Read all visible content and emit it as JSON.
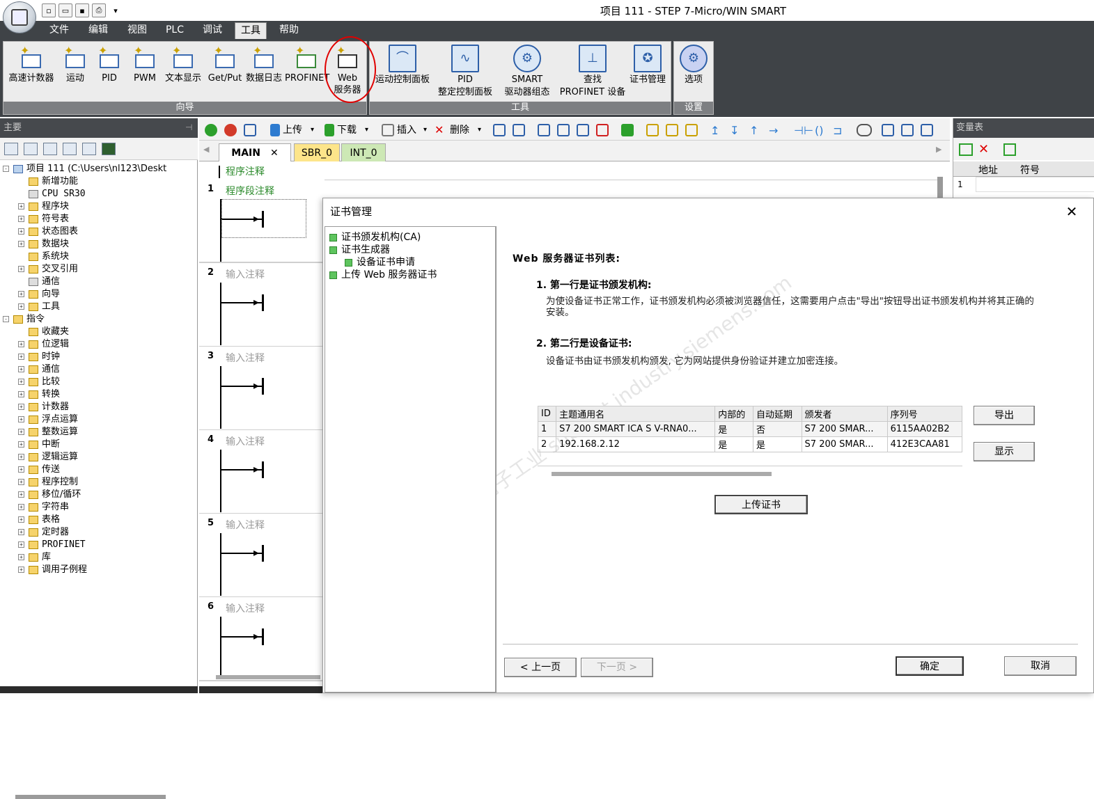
{
  "window": {
    "title": "项目 111 - STEP 7-Micro/WIN SMART"
  },
  "menu": [
    "文件",
    "编辑",
    "视图",
    "PLC",
    "调试",
    "工具",
    "帮助"
  ],
  "ribbon": {
    "wizard_group": "向导",
    "tools_group": "工具",
    "settings_group": "设置",
    "wizard_buttons": [
      "高速计数器",
      "运动",
      "PID",
      "PWM",
      "文本显示",
      "Get/Put",
      "数据日志",
      "PROFINET",
      "Web\n服务器"
    ],
    "tools_buttons": [
      "运动控制面板",
      "PID\n整定控制面板",
      "SMART\n驱动器组态",
      "查找\nPROFINET 设备",
      "证书管理"
    ],
    "settings_buttons": [
      "选项"
    ]
  },
  "left_panel": {
    "title": "主要",
    "tree": [
      {
        "label": "项目 111 (C:\\Users\\nl123\\Deskt",
        "level": 0,
        "exp": "-"
      },
      {
        "label": "新增功能",
        "level": 1,
        "exp": ""
      },
      {
        "label": "CPU SR30",
        "level": 1,
        "exp": ""
      },
      {
        "label": "程序块",
        "level": 1,
        "exp": "+"
      },
      {
        "label": "符号表",
        "level": 1,
        "exp": "+"
      },
      {
        "label": "状态图表",
        "level": 1,
        "exp": "+"
      },
      {
        "label": "数据块",
        "level": 1,
        "exp": "+"
      },
      {
        "label": "系统块",
        "level": 1,
        "exp": ""
      },
      {
        "label": "交叉引用",
        "level": 1,
        "exp": "+"
      },
      {
        "label": "通信",
        "level": 1,
        "exp": ""
      },
      {
        "label": "向导",
        "level": 1,
        "exp": "+"
      },
      {
        "label": "工具",
        "level": 1,
        "exp": "+"
      },
      {
        "label": "指令",
        "level": 0,
        "exp": "-"
      },
      {
        "label": "收藏夹",
        "level": 1,
        "exp": ""
      },
      {
        "label": "位逻辑",
        "level": 1,
        "exp": "+"
      },
      {
        "label": "时钟",
        "level": 1,
        "exp": "+"
      },
      {
        "label": "通信",
        "level": 1,
        "exp": "+"
      },
      {
        "label": "比较",
        "level": 1,
        "exp": "+"
      },
      {
        "label": "转换",
        "level": 1,
        "exp": "+"
      },
      {
        "label": "计数器",
        "level": 1,
        "exp": "+"
      },
      {
        "label": "浮点运算",
        "level": 1,
        "exp": "+"
      },
      {
        "label": "整数运算",
        "level": 1,
        "exp": "+"
      },
      {
        "label": "中断",
        "level": 1,
        "exp": "+"
      },
      {
        "label": "逻辑运算",
        "level": 1,
        "exp": "+"
      },
      {
        "label": "传送",
        "level": 1,
        "exp": "+"
      },
      {
        "label": "程序控制",
        "level": 1,
        "exp": "+"
      },
      {
        "label": "移位/循环",
        "level": 1,
        "exp": "+"
      },
      {
        "label": "字符串",
        "level": 1,
        "exp": "+"
      },
      {
        "label": "表格",
        "level": 1,
        "exp": "+"
      },
      {
        "label": "定时器",
        "level": 1,
        "exp": "+"
      },
      {
        "label": "PROFINET",
        "level": 1,
        "exp": "+"
      },
      {
        "label": "库",
        "level": 1,
        "exp": "+"
      },
      {
        "label": "调用子例程",
        "level": 1,
        "exp": "+"
      }
    ]
  },
  "editor": {
    "toolbar": {
      "upload": "上传",
      "download": "下载",
      "insert": "插入",
      "delete": "删除"
    },
    "tabs": [
      "MAIN",
      "SBR_0",
      "INT_0"
    ],
    "program_comment": "程序注释",
    "networks": [
      {
        "num": "1",
        "comment": "程序段注释"
      },
      {
        "num": "2",
        "comment": "输入注释"
      },
      {
        "num": "3",
        "comment": "输入注释"
      },
      {
        "num": "4",
        "comment": "输入注释"
      },
      {
        "num": "5",
        "comment": "输入注释"
      },
      {
        "num": "6",
        "comment": "输入注释"
      }
    ]
  },
  "var_panel": {
    "title": "变量表",
    "col_addr": "地址",
    "col_sym": "符号",
    "row1": "1"
  },
  "dialog": {
    "title": "证书管理",
    "close": "✕",
    "tree": [
      {
        "label": "证书颁发机构(CA)",
        "level": 0
      },
      {
        "label": "证书生成器",
        "level": 0
      },
      {
        "label": "设备证书申请",
        "level": 1
      },
      {
        "label": "上传 Web 服务器证书",
        "level": 0
      }
    ],
    "heading": "Web 服务器证书列表:",
    "item1_title": "1.  第一行是证书颁发机构:",
    "item1_text": "为使设备证书正常工作，证书颁发机构必须被浏览器信任，这需要用户点击\"导出\"按钮导出证书颁发机构并将其正确的安装。",
    "item2_title": "2.  第二行是设备证书:",
    "item2_text": "设备证书由证书颁发机构颁发, 它为网站提供身份验证并建立加密连接。",
    "table": {
      "headers": [
        "ID",
        "主题通用名",
        "内部的",
        "自动延期",
        "颁发者",
        "序列号"
      ],
      "rows": [
        [
          "1",
          "S7 200 SMART ICA S V-RNA0...",
          "是",
          "否",
          "S7 200 SMAR...",
          "6115AA02B2"
        ],
        [
          "2",
          "192.168.2.12",
          "是",
          "是",
          "S7 200 SMAR...",
          "412E3CAA81"
        ]
      ]
    },
    "export_btn": "导出",
    "show_btn": "显示",
    "upload_btn": "上传证书",
    "prev_btn": "< 上一页",
    "next_btn": "下一页 >",
    "ok_btn": "确定",
    "cancel_btn": "取消",
    "watermark": "西门子工业 support.industry.siemens.com"
  }
}
